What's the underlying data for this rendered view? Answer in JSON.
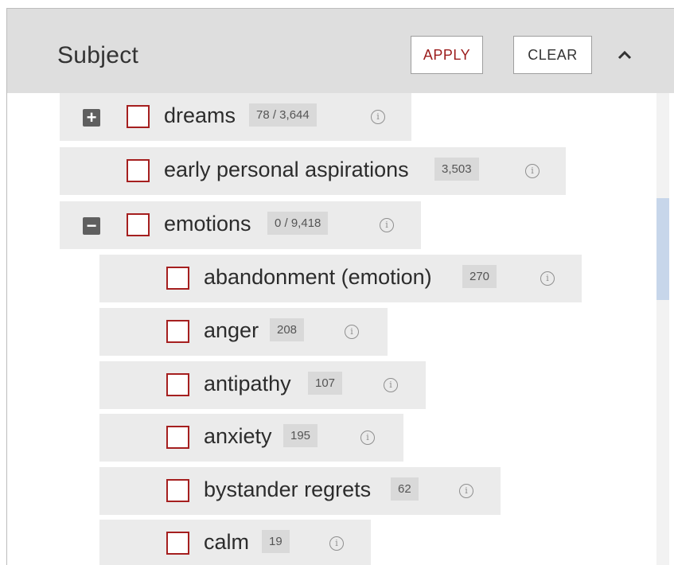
{
  "header": {
    "title": "Subject",
    "apply_label": "APPLY",
    "clear_label": "CLEAR",
    "collapse_icon": "chevron-up-icon"
  },
  "colors": {
    "accent": "#a51f1f",
    "header_bg": "#dedede",
    "row_bg": "#ebebeb",
    "count_bg": "#d9d9d9",
    "scroll_thumb": "#c7d6ea"
  },
  "items": [
    {
      "label": "dreams",
      "count": "78 / 3,644",
      "toggle": "+",
      "toggle_icon": "expand-icon"
    },
    {
      "label": "early personal aspirations",
      "count": "3,503"
    },
    {
      "label": "emotions",
      "count": "0 / 9,418",
      "toggle": "−",
      "toggle_icon": "collapse-icon"
    },
    {
      "label": "abandonment (emotion)",
      "count": "270"
    },
    {
      "label": "anger",
      "count": "208"
    },
    {
      "label": "antipathy",
      "count": "107"
    },
    {
      "label": "anxiety",
      "count": "195"
    },
    {
      "label": "bystander regrets",
      "count": "62"
    },
    {
      "label": "calm",
      "count": "19"
    }
  ],
  "info_glyph": "i"
}
